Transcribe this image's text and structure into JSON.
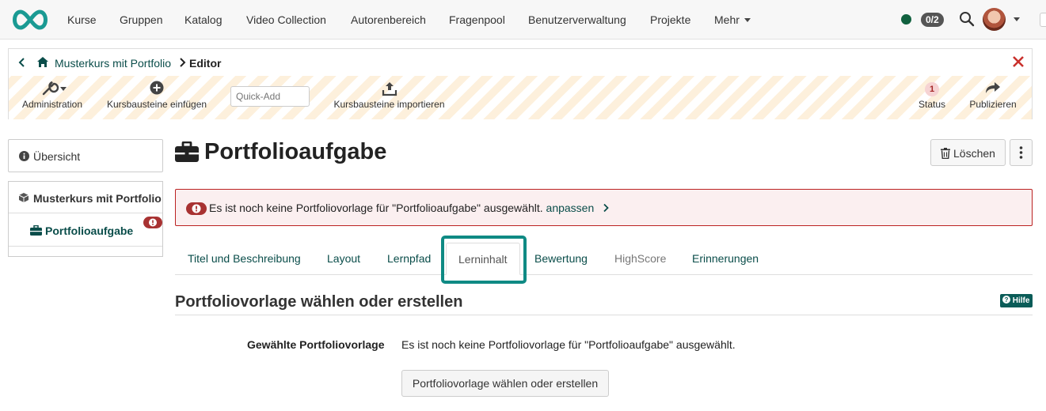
{
  "topnav": {
    "items": [
      "Kurse",
      "Gruppen",
      "Katalog",
      "Video Collection",
      "Autorenbereich",
      "Fragenpool",
      "Benutzerverwaltung",
      "Projekte"
    ],
    "more_label": "Mehr",
    "counter": "0/2",
    "status_color": "#11613f"
  },
  "editor": {
    "breadcrumb_course": "Musterkurs mit Portfolio",
    "breadcrumb_current": "Editor",
    "tools": {
      "administration": "Administration",
      "insert": "Kursbausteine einfügen",
      "quickadd_placeholder": "Quick-Add",
      "import": "Kursbausteine importieren",
      "status": "Status",
      "status_count": "1",
      "publish": "Publizieren"
    }
  },
  "sidebar": {
    "overview": "Übersicht",
    "course": "Musterkurs mit Portfolio",
    "node": "Portfolioaufgabe"
  },
  "main": {
    "title": "Portfolioaufgabe",
    "delete_label": "Löschen",
    "alert_text": "Es ist noch keine Portfoliovorlage für \"Portfolioaufgabe\" ausgewählt.",
    "alert_link": "anpassen",
    "tabs": {
      "title": "Titel und Beschreibung",
      "layout": "Layout",
      "path": "Lernpfad",
      "content": "Lerninhalt",
      "assessment": "Bewertung",
      "highscore": "HighScore",
      "reminders": "Erinnerungen"
    },
    "section_title": "Portfoliovorlage wählen oder erstellen",
    "help_label": "Hilfe",
    "field_label": "Gewählte Portfoliovorlage",
    "field_value": "Es ist noch keine Portfoliovorlage für \"Portfolioaufgabe\" ausgewählt.",
    "choose_button": "Portfoliovorlage wählen oder erstellen"
  },
  "colors": {
    "accent": "#0a4d4a",
    "highlight": "#0f8a84",
    "danger": "#a83232"
  }
}
